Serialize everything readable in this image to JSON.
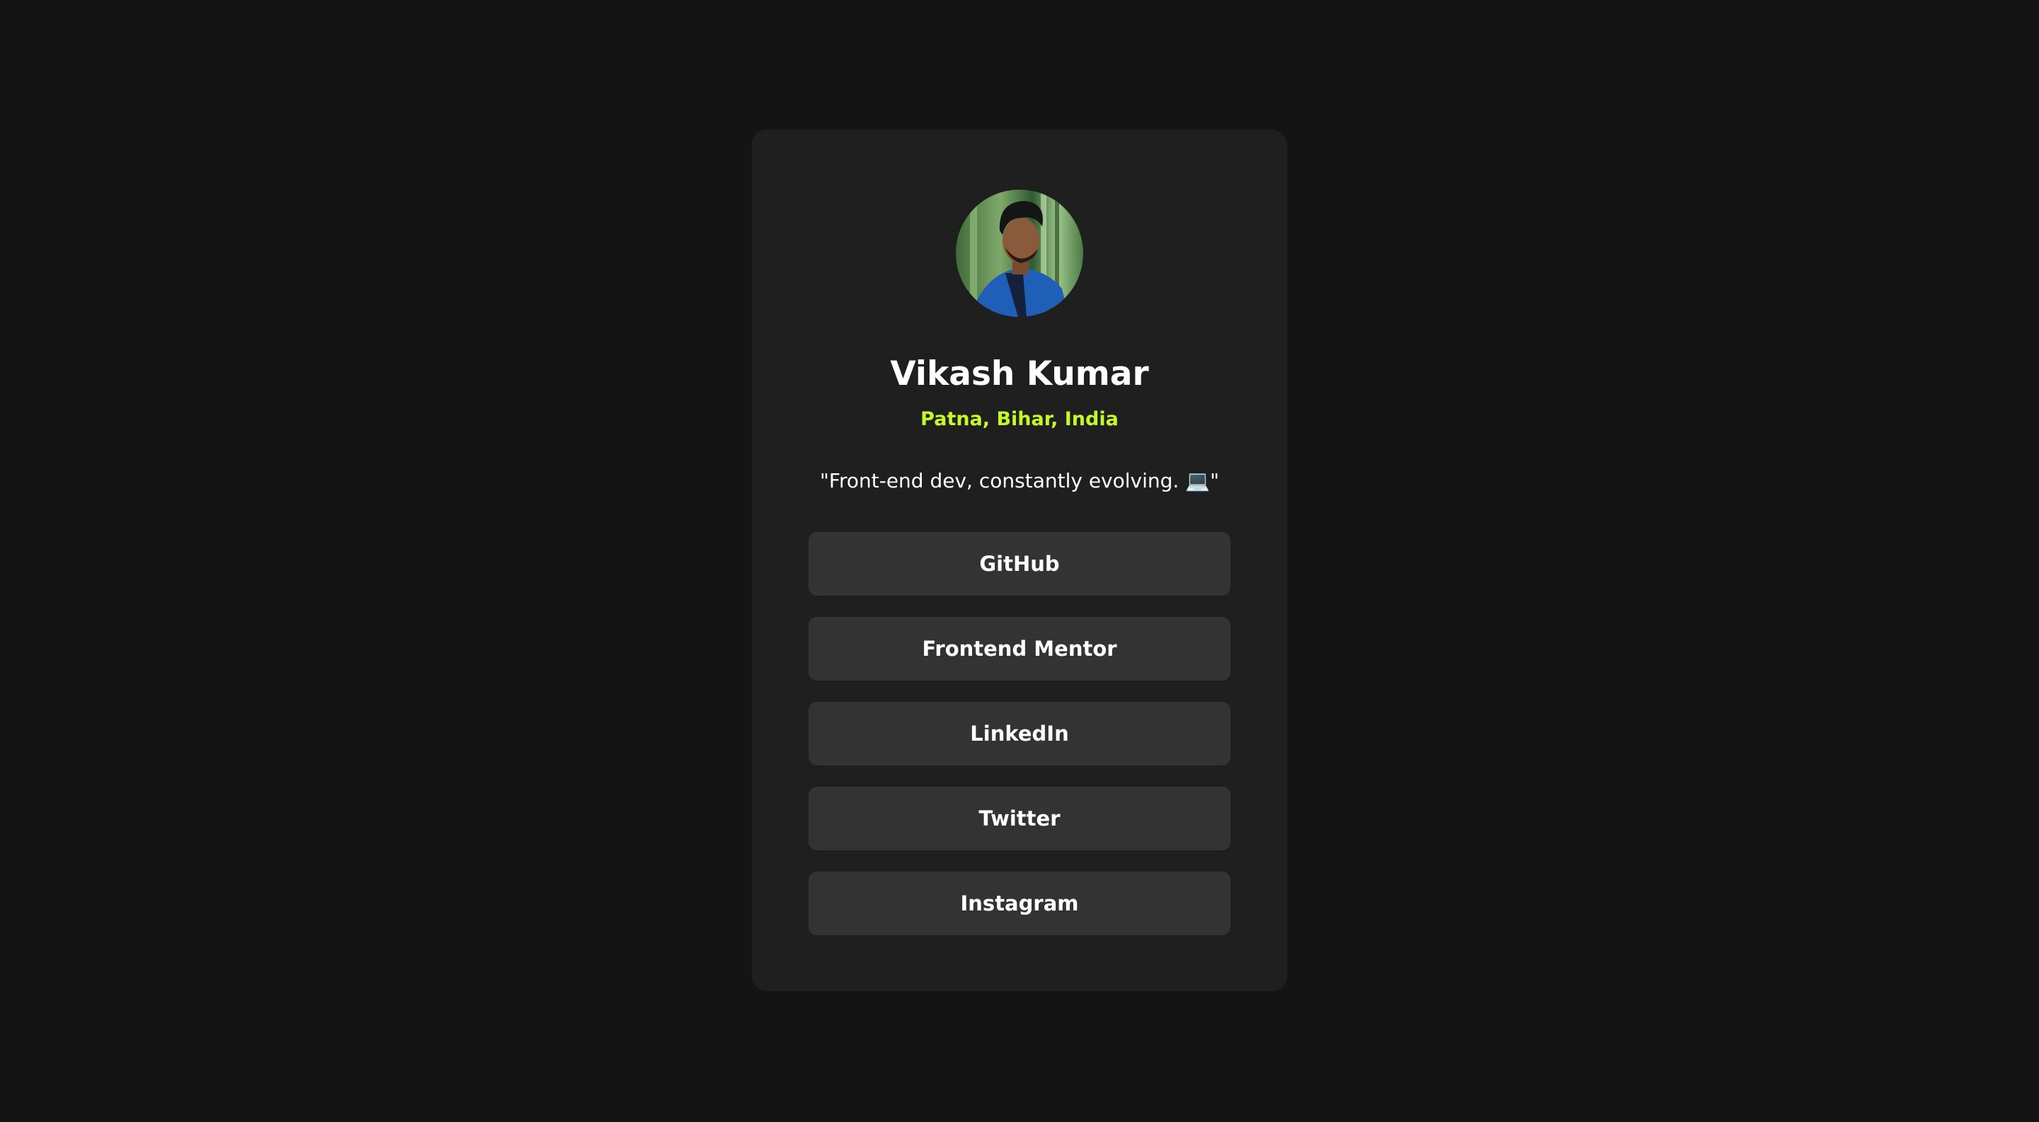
{
  "profile": {
    "name": "Vikash Kumar",
    "location": "Patna, Bihar, India",
    "bio": "\"Front-end dev, constantly evolving. 💻\""
  },
  "links": [
    {
      "label": "GitHub"
    },
    {
      "label": "Frontend Mentor"
    },
    {
      "label": "LinkedIn"
    },
    {
      "label": "Twitter"
    },
    {
      "label": "Instagram"
    }
  ],
  "colors": {
    "page_background": "#141414",
    "card_background": "#1f1f1f",
    "button_background": "#333333",
    "accent": "#c4f82a",
    "text": "#ffffff"
  }
}
